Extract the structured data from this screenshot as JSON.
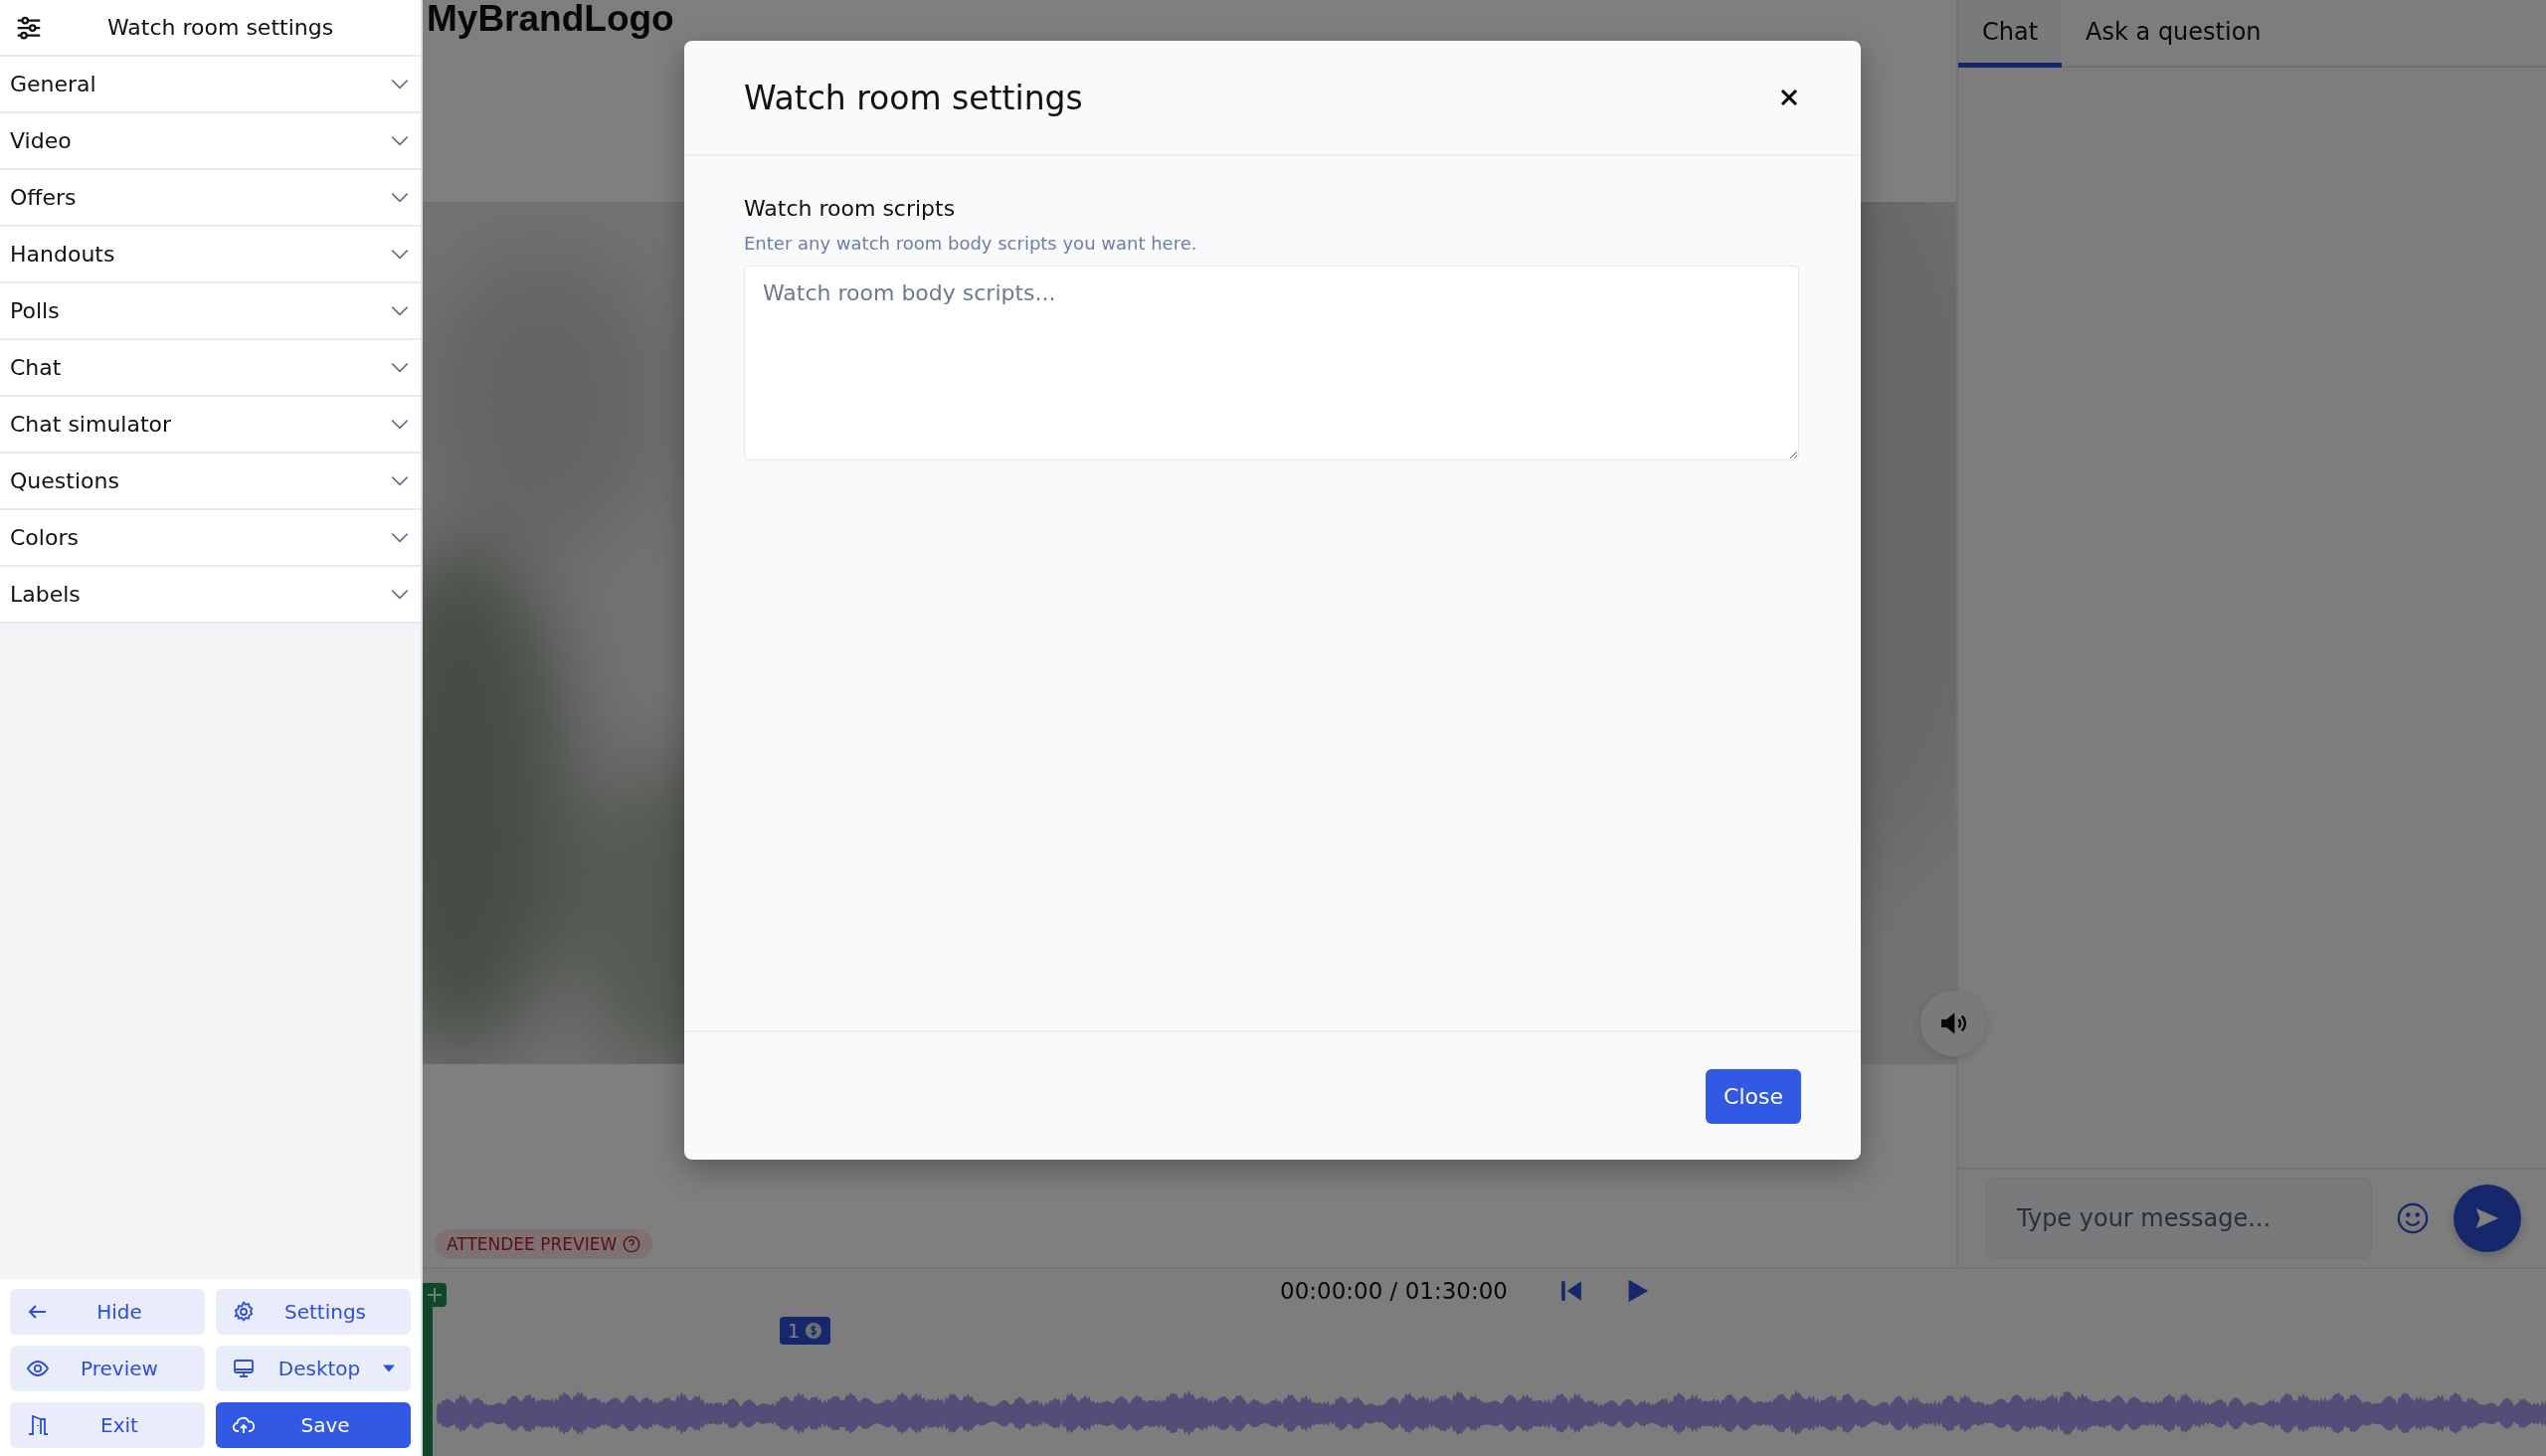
{
  "sidebar": {
    "title": "Watch room settings",
    "sections": [
      {
        "label": "General",
        "expanded": false
      },
      {
        "label": "Video",
        "expanded": false
      },
      {
        "label": "Offers",
        "expanded": false
      },
      {
        "label": "Handouts",
        "expanded": false
      },
      {
        "label": "Polls",
        "expanded": false
      },
      {
        "label": "Chat",
        "expanded": false
      },
      {
        "label": "Chat simulator",
        "expanded": false
      },
      {
        "label": "Questions",
        "expanded": false
      },
      {
        "label": "Colors",
        "expanded": false
      },
      {
        "label": "Labels",
        "expanded": false
      }
    ],
    "buttons": [
      {
        "label": "Hide",
        "kind": "hide",
        "primary": false,
        "dropdown": false
      },
      {
        "label": "Settings",
        "kind": "settings",
        "primary": false,
        "dropdown": false
      },
      {
        "label": "Preview",
        "kind": "preview",
        "primary": false,
        "dropdown": false
      },
      {
        "label": "Desktop",
        "kind": "device",
        "primary": false,
        "dropdown": true
      },
      {
        "label": "Exit",
        "kind": "exit",
        "primary": false,
        "dropdown": false
      },
      {
        "label": "Save",
        "kind": "save",
        "primary": true,
        "dropdown": false
      }
    ]
  },
  "header": {
    "logo": "MyBrandLogo"
  },
  "preview_badge": "ATTENDEE PREVIEW",
  "player": {
    "time": "00:00:00 / 01:30:00",
    "offer_marker": "1"
  },
  "chat": {
    "tabs": [
      {
        "label": "Chat",
        "selected": true
      },
      {
        "label": "Ask a question",
        "selected": false
      }
    ],
    "message": {
      "placeholder": "Type your message..."
    }
  },
  "modal": {
    "title": "Watch room settings",
    "field": {
      "label": "Watch room scripts",
      "help": "Enter any watch room body scripts you want here.",
      "placeholder": "Watch room body scripts..."
    },
    "close_button": "Close"
  }
}
